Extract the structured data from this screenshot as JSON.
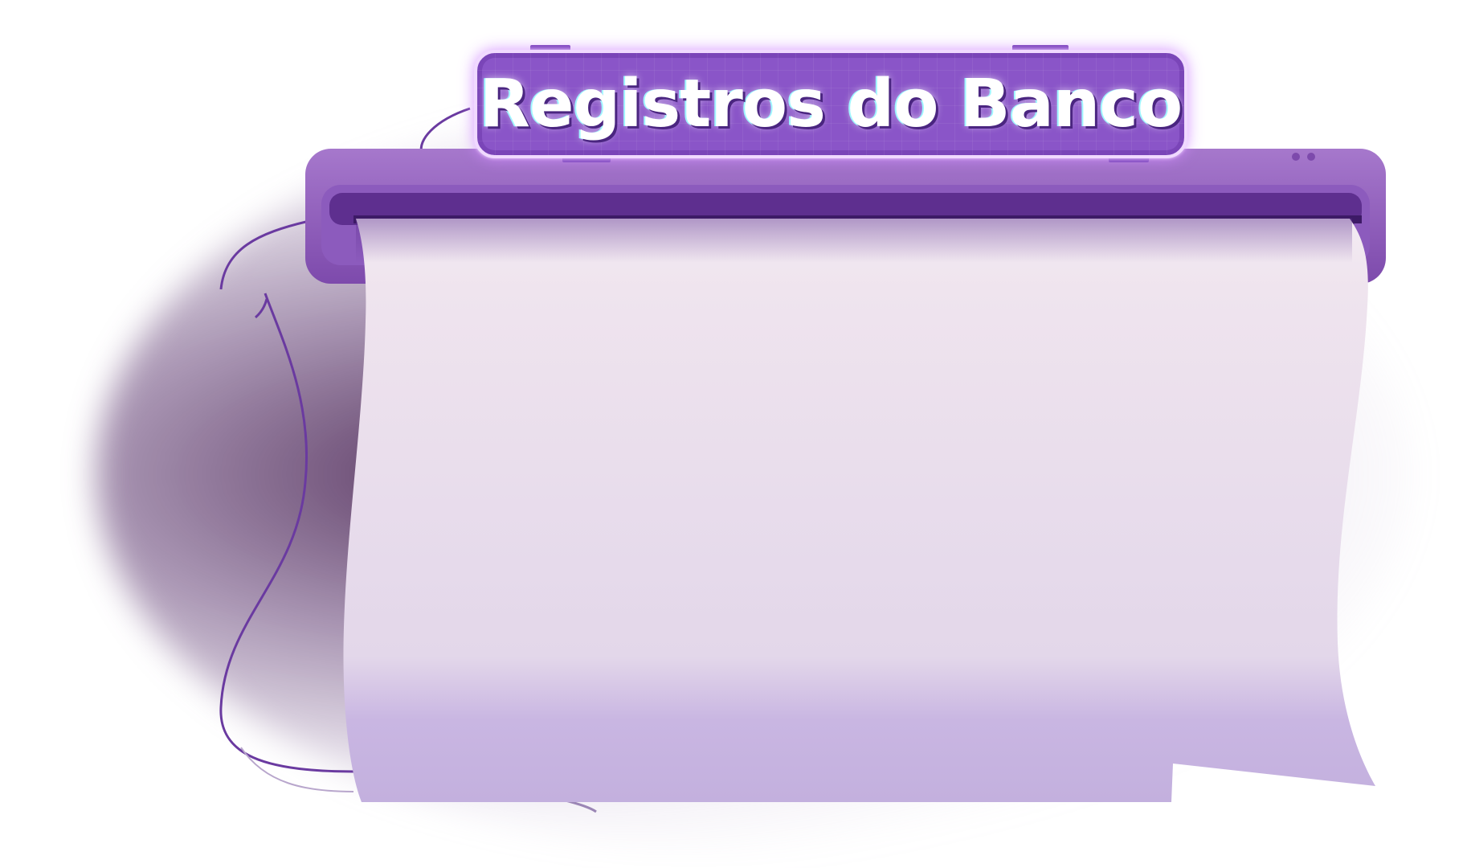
{
  "panel": {
    "title": "Registros do Banco"
  },
  "colors": {
    "slot_body": "#9b6ec4",
    "slot_dark": "#5e2f8f",
    "paper_top": "#efe6f0",
    "paper_bottom": "#c6b2e0",
    "sign_fill": "#8a55c8",
    "sign_border": "#f0d9ff",
    "wire": "#6a3aa0"
  }
}
